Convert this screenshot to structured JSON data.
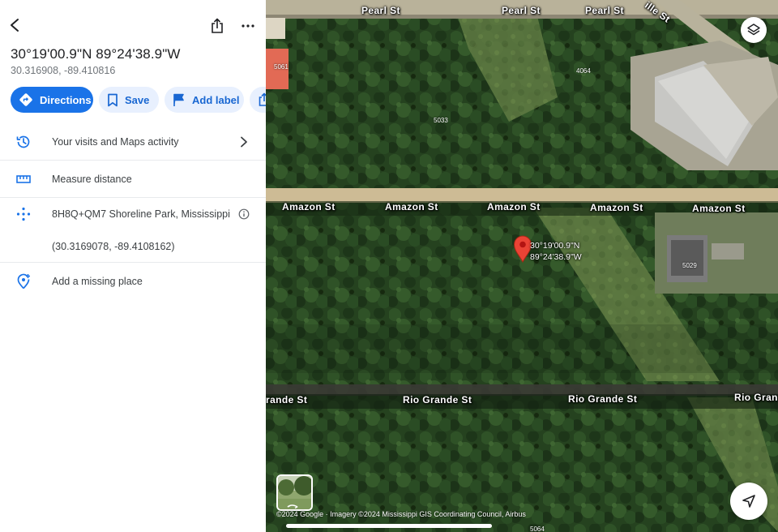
{
  "place": {
    "title": "30°19'00.9\"N 89°24'38.9\"W",
    "decimal": "30.316908, -89.410816"
  },
  "actions": {
    "directions": "Directions",
    "save": "Save",
    "add_label": "Add label"
  },
  "rows": {
    "visits": "Your visits and Maps activity",
    "measure": "Measure distance",
    "plus_code": "8H8Q+QM7 Shoreline Park, Mississippi",
    "coords_precise": "(30.3169078, -89.4108162)",
    "add_missing": "Add a missing place"
  },
  "map": {
    "streets": {
      "pearl_1": "Pearl St",
      "pearl_2": "Pearl St",
      "pearl_3": "Pearl St",
      "amazon_1": "Amazon St",
      "amazon_2": "Amazon St",
      "amazon_3": "Amazon St",
      "amazon_4": "Amazon St",
      "amazon_5": "Amazon St",
      "rio_1": "rande St",
      "rio_2": "Rio Grande St",
      "rio_3": "Rio Grande St",
      "rio_4": "Rio Gran",
      "diag": "ille St"
    },
    "addresses": {
      "a5061": "5061",
      "a4064": "4064",
      "a5033": "5033",
      "a5029": "5029",
      "a5064": "5064"
    },
    "pin_label_line1": "30°19'00.9\"N",
    "pin_label_line2": "89°24'38.9\"W",
    "attribution": "©2024 Google · Imagery ©2024 Mississippi GIS Coordinating Council, Airbus"
  },
  "colors": {
    "accent": "#1a73e8",
    "chip_bg": "#e8f0fe",
    "pin": "#ea4335"
  },
  "icons": [
    "back-icon",
    "share-icon",
    "more-icon",
    "directions-icon",
    "bookmark-icon",
    "flag-icon",
    "history-icon",
    "ruler-icon",
    "plus-code-icon",
    "info-icon",
    "add-place-icon",
    "chevron-right-icon",
    "layers-icon",
    "navigate-icon",
    "pin-icon"
  ]
}
